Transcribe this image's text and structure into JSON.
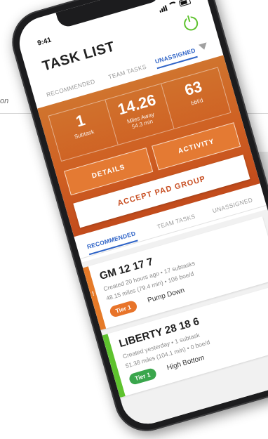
{
  "background": {
    "fragment_text": "on"
  },
  "status": {
    "time": "9:41"
  },
  "header": {
    "title": "TASK LIST"
  },
  "top_tabs": [
    {
      "label": "RECOMMENDED"
    },
    {
      "label": "TEAM TASKS"
    },
    {
      "label": "UNASSIGNED"
    }
  ],
  "stats": [
    {
      "value": "1",
      "label": "Subtask",
      "sub": ""
    },
    {
      "value": "14.26",
      "label": "Miles Away",
      "sub": "54.3 min"
    },
    {
      "value": "63",
      "label": "bbl/d",
      "sub": ""
    }
  ],
  "buttons": {
    "details": "DETAILS",
    "activity": "ACTIVITY",
    "accept": "ACCEPT PAD GROUP"
  },
  "bottom_tabs": [
    {
      "label": "RECOMMENDED"
    },
    {
      "label": "TEAM TASKS"
    },
    {
      "label": "UNASSIGNED"
    }
  ],
  "tasks": [
    {
      "name": "GM 12 17 7",
      "meta": "Created 20 hours ago • 17 subtasks",
      "meta2": "48.15 miles (79.4 min) • 106 boe/d",
      "tier": "Tier 1",
      "activity": "Pump Down",
      "accent_color": "#e57a28",
      "tier_color": "#e8742a"
    },
    {
      "name": "LIBERTY 28 18 6",
      "meta": "Created yesterday • 1 subtask",
      "meta2": "51.38 miles (104.1 min) • 0 boe/d",
      "tier": "Tier 1",
      "activity": "High Bottom",
      "accent_color": "#5ec22e",
      "tier_color": "#3aa64c"
    }
  ],
  "colors": {
    "accent_blue": "#2e63c7",
    "orange": "#cf5f22",
    "power_green": "#5ec22e"
  }
}
